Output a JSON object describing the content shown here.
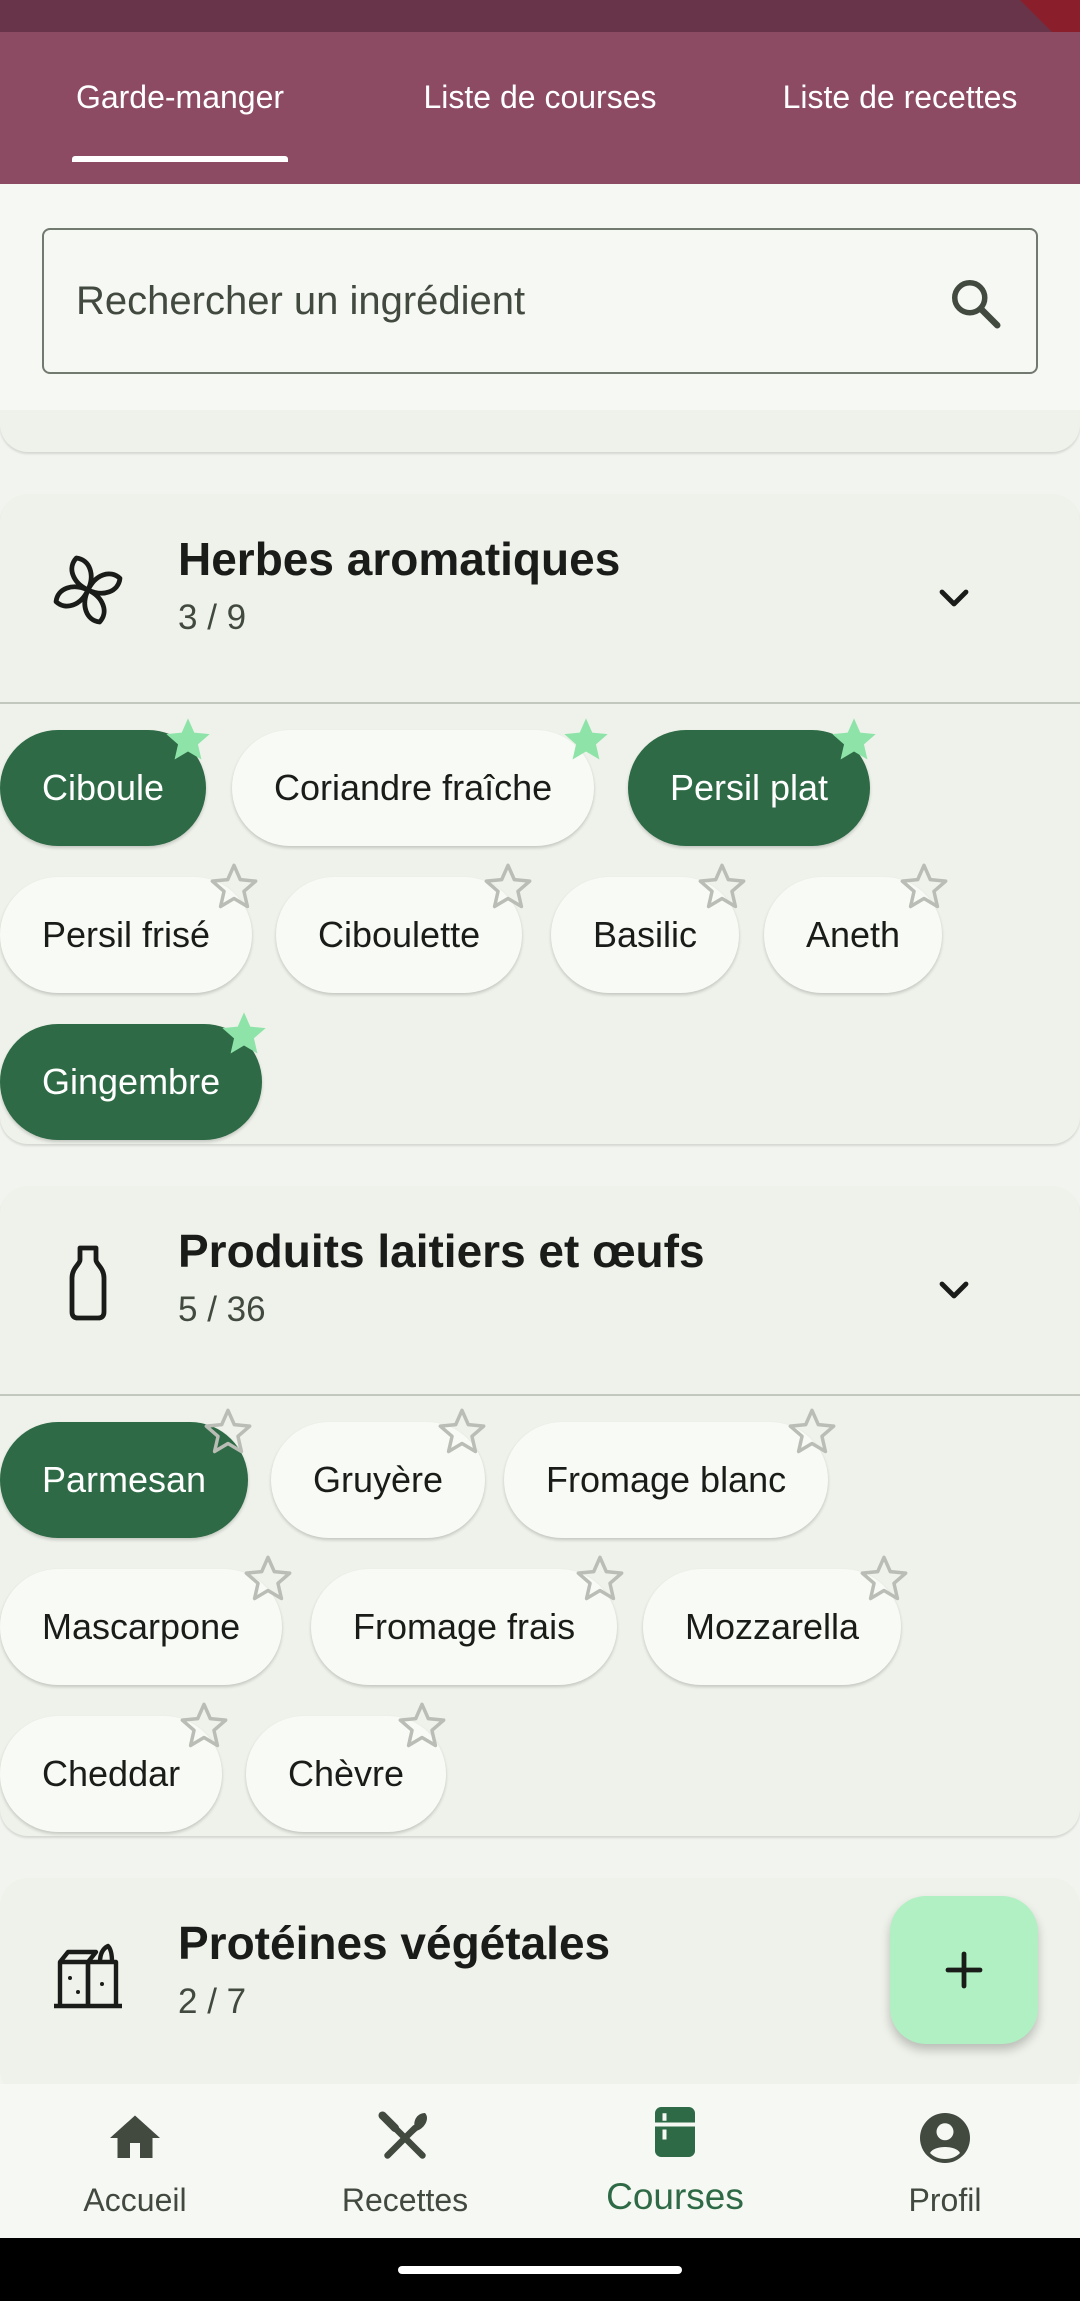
{
  "tabs": [
    {
      "label": "Garde-manger",
      "active": true
    },
    {
      "label": "Liste de courses",
      "active": false
    },
    {
      "label": "Liste de recettes",
      "active": false
    }
  ],
  "search": {
    "placeholder": "Rechercher un ingrédient",
    "icon": "search-icon"
  },
  "categories": [
    {
      "title": "Herbes aromatiques",
      "count": "3 / 9",
      "icon": "herb-icon",
      "chips": [
        {
          "label": "Ciboule",
          "selected": true,
          "starred": true
        },
        {
          "label": "Coriandre fraîche",
          "selected": false,
          "starred": true
        },
        {
          "label": "Persil plat",
          "selected": true,
          "starred": true
        },
        {
          "label": "Persil frisé",
          "selected": false,
          "starred": false
        },
        {
          "label": "Ciboulette",
          "selected": false,
          "starred": false
        },
        {
          "label": "Basilic",
          "selected": false,
          "starred": false
        },
        {
          "label": "Aneth",
          "selected": false,
          "starred": false
        },
        {
          "label": "Gingembre",
          "selected": true,
          "starred": true
        }
      ]
    },
    {
      "title": "Produits laitiers et œufs",
      "count": "5 / 36",
      "icon": "milk-bottle-icon",
      "chips": [
        {
          "label": "Parmesan",
          "selected": true,
          "starred": false
        },
        {
          "label": "Gruyère",
          "selected": false,
          "starred": false
        },
        {
          "label": "Fromage blanc",
          "selected": false,
          "starred": false
        },
        {
          "label": "Mascarpone",
          "selected": false,
          "starred": false
        },
        {
          "label": "Fromage frais",
          "selected": false,
          "starred": false
        },
        {
          "label": "Mozzarella",
          "selected": false,
          "starred": false
        },
        {
          "label": "Cheddar",
          "selected": false,
          "starred": false
        },
        {
          "label": "Chèvre",
          "selected": false,
          "starred": false
        }
      ]
    },
    {
      "title": "Protéines végétales",
      "count": "2 / 7",
      "icon": "tofu-icon"
    }
  ],
  "fab": {
    "icon": "plus-icon"
  },
  "bottom_nav": [
    {
      "label": "Accueil",
      "icon": "home-icon",
      "active": false
    },
    {
      "label": "Recettes",
      "icon": "utensils-icon",
      "active": false
    },
    {
      "label": "Courses",
      "icon": "fridge-icon",
      "active": true
    },
    {
      "label": "Profil",
      "icon": "profile-icon",
      "active": false
    }
  ],
  "colors": {
    "app_bar": "#8c4a63",
    "status_bar": "#673449",
    "chip_selected": "#2d6a45",
    "star_filled": "#8ee4a8",
    "fab": "#b1f0c3",
    "nav_active": "#2d6a45"
  }
}
